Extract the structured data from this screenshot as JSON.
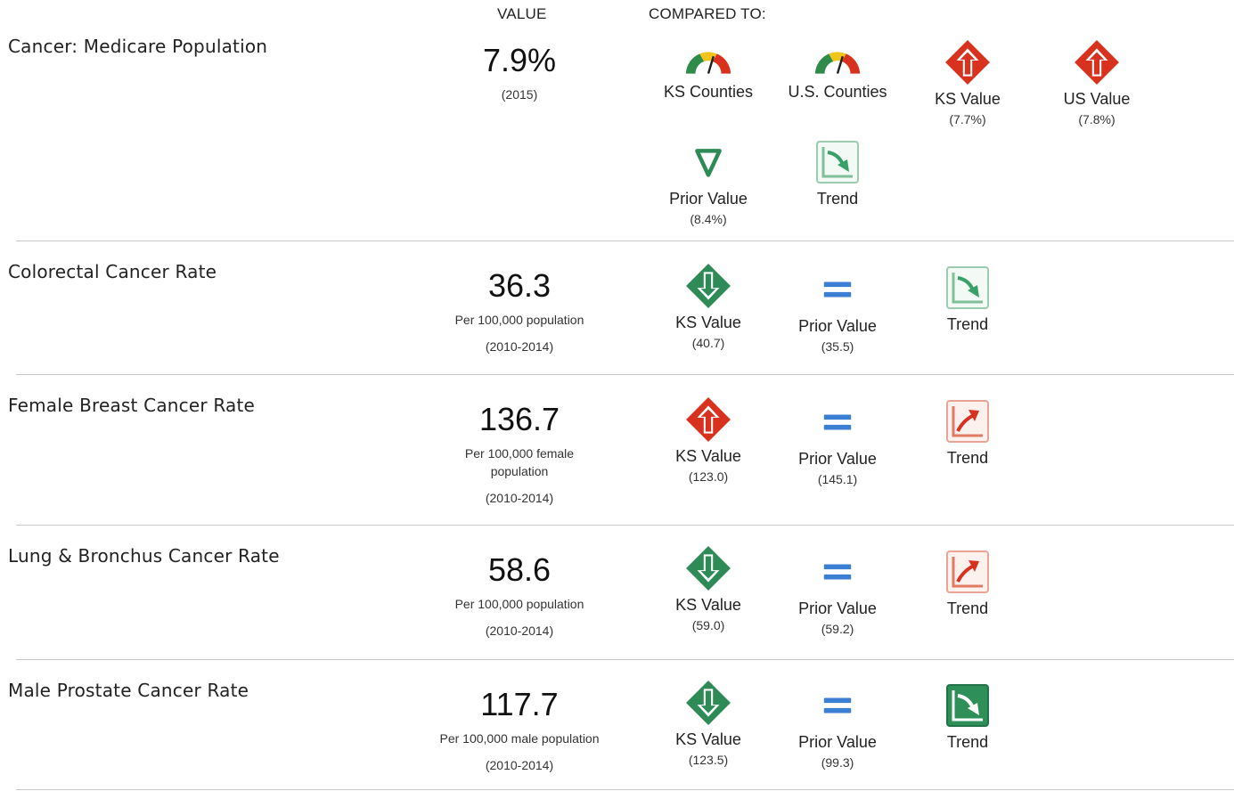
{
  "header": {
    "value_label": "VALUE",
    "compared_label": "COMPARED TO:"
  },
  "colors": {
    "good": "#2e8b57",
    "bad": "#d8321f",
    "neutral": "#3b7fd4",
    "trend_bad": "#e0553a",
    "trend_good": "#2f8f58"
  },
  "rows": [
    {
      "title": "Cancer: Medicare Population",
      "value": "7.9%",
      "unit": "",
      "year": "(2015)",
      "comparisons": [
        {
          "icon": "gauge-icon",
          "label": "KS Counties",
          "sub": ""
        },
        {
          "icon": "gauge-icon",
          "label": "U.S. Counties",
          "sub": ""
        },
        {
          "icon": "red-diamond-up-icon",
          "label": "KS Value",
          "sub": "(7.7%)"
        },
        {
          "icon": "red-diamond-up-icon",
          "label": "US Value",
          "sub": "(7.8%)"
        },
        {
          "icon": "green-triangle-down-icon",
          "label": "Prior Value",
          "sub": "(8.4%)"
        },
        {
          "icon": "trend-down-light-icon",
          "label": "Trend",
          "sub": ""
        }
      ]
    },
    {
      "title": "Colorectal Cancer Rate",
      "value": "36.3",
      "unit": "Per 100,000 population",
      "year": "(2010-2014)",
      "comparisons": [
        {
          "icon": "green-diamond-down-icon",
          "label": "KS Value",
          "sub": "(40.7)"
        },
        {
          "icon": "blue-equals-icon",
          "label": "Prior Value",
          "sub": "(35.5)"
        },
        {
          "icon": "trend-down-light-icon",
          "label": "Trend",
          "sub": ""
        }
      ]
    },
    {
      "title": "Female Breast Cancer Rate",
      "value": "136.7",
      "unit": "Per 100,000 female population",
      "year": "(2010-2014)",
      "comparisons": [
        {
          "icon": "red-diamond-up-icon",
          "label": "KS Value",
          "sub": "(123.0)"
        },
        {
          "icon": "blue-equals-icon",
          "label": "Prior Value",
          "sub": "(145.1)"
        },
        {
          "icon": "trend-up-red-icon",
          "label": "Trend",
          "sub": ""
        }
      ]
    },
    {
      "title": "Lung & Bronchus Cancer Rate",
      "value": "58.6",
      "unit": "Per 100,000 population",
      "year": "(2010-2014)",
      "comparisons": [
        {
          "icon": "green-diamond-down-icon",
          "label": "KS Value",
          "sub": "(59.0)"
        },
        {
          "icon": "blue-equals-icon",
          "label": "Prior Value",
          "sub": "(59.2)"
        },
        {
          "icon": "trend-up-red-icon",
          "label": "Trend",
          "sub": ""
        }
      ]
    },
    {
      "title": "Male Prostate Cancer Rate",
      "value": "117.7",
      "unit": "Per 100,000 male population",
      "year": "(2010-2014)",
      "comparisons": [
        {
          "icon": "green-diamond-down-icon",
          "label": "KS Value",
          "sub": "(123.5)"
        },
        {
          "icon": "blue-equals-icon",
          "label": "Prior Value",
          "sub": "(99.3)"
        },
        {
          "icon": "trend-down-dark-icon",
          "label": "Trend",
          "sub": ""
        }
      ]
    }
  ]
}
